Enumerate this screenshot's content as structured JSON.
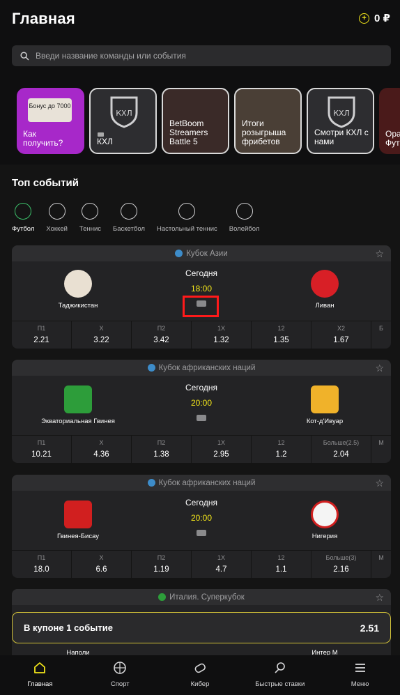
{
  "header": {
    "title": "Главная",
    "balance": "0 ₽",
    "coin_icon": "coin-icon"
  },
  "search": {
    "placeholder": "Введи название команды или события"
  },
  "promos": [
    {
      "label": "Как получить?",
      "badge": "Бонус до 7000"
    },
    {
      "label": "КХЛ"
    },
    {
      "label": "BetBoom Streamers Battle 5"
    },
    {
      "label": "Итоги розыгрыша фрибетов"
    },
    {
      "label": "Смотри КХЛ с нами"
    },
    {
      "label": "Оракул Футбол"
    }
  ],
  "top_events": {
    "title": "Топ событий",
    "sports": [
      "Футбол",
      "Хоккей",
      "Теннис",
      "Баскетбол",
      "Настольный теннис",
      "Волейбол"
    ]
  },
  "matches": [
    {
      "league": "Кубок Азии",
      "home": "Таджикистан",
      "away": "Ливан",
      "day": "Сегодня",
      "time": "18:00",
      "odds": [
        {
          "k": "П1",
          "v": "2.21"
        },
        {
          "k": "Х",
          "v": "3.22"
        },
        {
          "k": "П2",
          "v": "3.42"
        },
        {
          "k": "1Х",
          "v": "1.32"
        },
        {
          "k": "12",
          "v": "1.35"
        },
        {
          "k": "Х2",
          "v": "1.67"
        },
        {
          "k": "Б",
          "v": ""
        }
      ]
    },
    {
      "league": "Кубок африканских наций",
      "home": "Экваториальная Гвинея",
      "away": "Кот-д'Ивуар",
      "day": "Сегодня",
      "time": "20:00",
      "odds": [
        {
          "k": "П1",
          "v": "10.21"
        },
        {
          "k": "Х",
          "v": "4.36"
        },
        {
          "k": "П2",
          "v": "1.38"
        },
        {
          "k": "1Х",
          "v": "2.95"
        },
        {
          "k": "12",
          "v": "1.2"
        },
        {
          "k": "Больше(2.5)",
          "v": "2.04"
        },
        {
          "k": "М",
          "v": ""
        }
      ]
    },
    {
      "league": "Кубок африканских наций",
      "home": "Гвинея-Бисау",
      "away": "Нигерия",
      "day": "Сегодня",
      "time": "20:00",
      "odds": [
        {
          "k": "П1",
          "v": "18.0"
        },
        {
          "k": "Х",
          "v": "6.6"
        },
        {
          "k": "П2",
          "v": "1.19"
        },
        {
          "k": "1Х",
          "v": "4.7"
        },
        {
          "k": "12",
          "v": "1.1"
        },
        {
          "k": "Больше(3)",
          "v": "2.16"
        },
        {
          "k": "М",
          "v": ""
        }
      ]
    },
    {
      "league": "Италия. Суперкубок",
      "home": "Наполи",
      "away": "Интер М"
    }
  ],
  "coupon": {
    "label": "В купоне 1 событие",
    "value": "2.51"
  },
  "nav": [
    "Главная",
    "Спорт",
    "Кибер",
    "Быстрые ставки",
    "Меню"
  ],
  "colors": {
    "accent": "#f2e51a",
    "highlight": "#ff1a1a",
    "active_sport": "#3cc26b"
  }
}
